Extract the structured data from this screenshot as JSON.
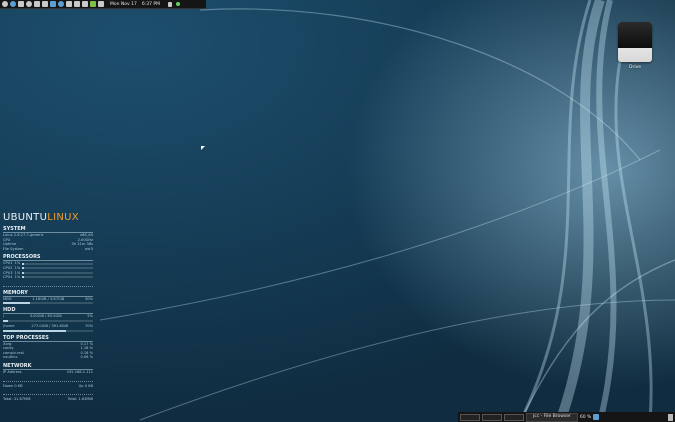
{
  "top_panel": {
    "clock_date": "Mon Nov 17",
    "clock_time": "6:37 PM",
    "icons": [
      "ubuntu-icon",
      "firefox-icon",
      "terminal-icon",
      "rhythmbox-icon",
      "pidgin-icon",
      "files-icon",
      "chat-icon",
      "globe-icon",
      "email-icon",
      "camera-icon",
      "image-icon",
      "media-icon",
      "update-icon",
      "bluetooth-icon",
      "network-icon"
    ]
  },
  "desktop": {
    "drive_label": "Drive"
  },
  "conky": {
    "brand_part1": "UBUNTU",
    "brand_part2": "LINUX",
    "system": {
      "title": "SYSTEM",
      "rows": [
        {
          "label": "Linux 2.6.27-7-generic",
          "value": "x86_64"
        },
        {
          "label": "CPU",
          "value": "2.00GHz"
        },
        {
          "label": "Uptime",
          "value": "0h 21m 38s"
        },
        {
          "label": "File System",
          "value": "ext3"
        }
      ]
    },
    "processors": {
      "title": "PROCESSORS",
      "cpus": [
        {
          "label": "CPU1",
          "pct": "1%",
          "level": 0.03
        },
        {
          "label": "CPU2",
          "pct": "1%",
          "level": 0.03
        },
        {
          "label": "CPU3",
          "pct": "1%",
          "level": 0.03
        },
        {
          "label": "CPU4",
          "pct": "1%",
          "level": 0.03
        }
      ]
    },
    "memory": {
      "title": "MEMORY",
      "label": "MEM",
      "used": "1.16GiB",
      "total": "3.87GiB",
      "pct": "30%",
      "level": 0.3
    },
    "hdd": {
      "title": "HDD",
      "rows": [
        {
          "label": "/",
          "used": "3.00GiB",
          "total": "63.5GiB",
          "pct": "5%",
          "level": 0.05
        },
        {
          "label": "/home",
          "used": "277.0GiB",
          "total": "391.6GiB",
          "pct": "70%",
          "level": 0.7
        }
      ]
    },
    "top_processes": {
      "title": "TOP PROCESSES",
      "rows": [
        {
          "name": "Xorg",
          "pct": "0.17 %"
        },
        {
          "name": "conky",
          "pct": "1.18 %"
        },
        {
          "name": "compiz.real",
          "pct": "0.18 %"
        },
        {
          "name": "nautilus",
          "pct": "0.06 %"
        }
      ]
    },
    "network": {
      "title": "NETWORK",
      "ip_label": "IP Address",
      "ip_value": "192.168.1.111",
      "down_label": "Down",
      "down_value": "0 KB",
      "up_label": "Up",
      "up_value": "0 KB",
      "total_down": "Total: 31.67MiB",
      "total_up": "Total: 1.63MiB"
    }
  },
  "bottom_panel": {
    "task_label": "jcc - File Browser",
    "volume": "60 %"
  }
}
